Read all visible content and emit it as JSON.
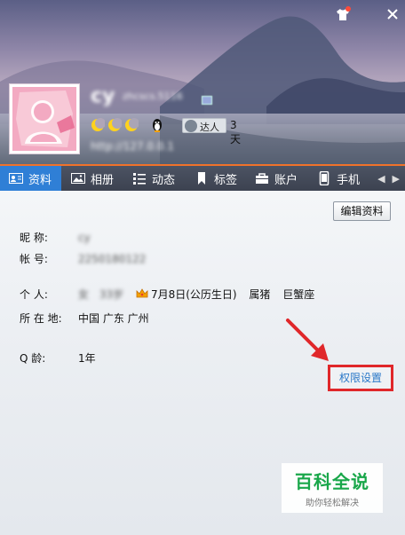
{
  "header": {
    "nickname": "cy",
    "nickname_extra": "zhcscs.5116",
    "signature": "http://127.0.0.1",
    "daren_label": "达人",
    "days": "3天",
    "icons": [
      "skin-icon",
      "close-icon",
      "moon-icon",
      "penguin-icon",
      "daren-icon"
    ]
  },
  "tabs": [
    {
      "label": "资料",
      "icon": "profile-card-icon",
      "active": true
    },
    {
      "label": "相册",
      "icon": "photo-icon",
      "active": false
    },
    {
      "label": "动态",
      "icon": "list-icon",
      "active": false
    },
    {
      "label": "标签",
      "icon": "bookmark-icon",
      "active": false
    },
    {
      "label": "账户",
      "icon": "briefcase-icon",
      "active": false
    },
    {
      "label": "手机",
      "icon": "phone-icon",
      "active": false
    }
  ],
  "toolbar": {
    "edit_label": "编辑资料"
  },
  "profile": {
    "nickname_label": "昵    称:",
    "nickname_value": "cy",
    "account_label": "帐    号:",
    "account_value": "2250180122",
    "personal_label": "个    人:",
    "personal_gender": "女",
    "personal_age": "33岁",
    "birthday": "7月8日(公历生日)",
    "zodiac": "属猪",
    "constellation": "巨蟹座",
    "location_label": "所 在 地:",
    "location_value": "中国 广东 广州",
    "qage_label": "Q    龄:",
    "qage_value": "1年"
  },
  "permission_link": "权限设置",
  "watermark": {
    "title": "百科全说",
    "subtitle": "助你轻松解决"
  },
  "colors": {
    "accent_tab": "#2f7fd6",
    "tab_top_line": "#f0722a",
    "highlight": "#e0272a",
    "watermark": "#19a74a"
  }
}
